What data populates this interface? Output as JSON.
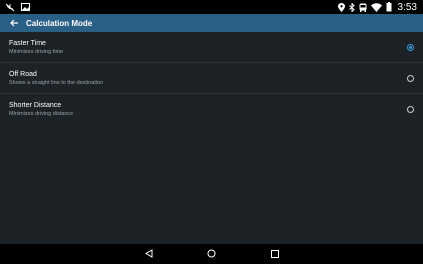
{
  "status_bar": {
    "time": "3:53",
    "left_icons": [
      "no-sim-icon",
      "image-icon"
    ],
    "right_icons": [
      "location-icon",
      "bluetooth-icon",
      "bus-icon",
      "wifi-icon",
      "battery-icon"
    ]
  },
  "app_bar": {
    "back_icon": "arrow-back-icon",
    "title": "Calculation Mode"
  },
  "options": [
    {
      "title": "Faster Time",
      "subtitle": "Minimizes driving time",
      "selected": true
    },
    {
      "title": "Off Road",
      "subtitle": "Shows a straight line to the destination",
      "selected": false
    },
    {
      "title": "Shorter Distance",
      "subtitle": "Minimizes driving distance",
      "selected": false
    }
  ],
  "nav_bar": {
    "buttons": [
      "back-triangle-icon",
      "home-circle-icon",
      "recents-square-icon"
    ]
  },
  "colors": {
    "app_bar": "#2a5f86",
    "background": "#1d2226",
    "accent": "#3f9fe0"
  }
}
